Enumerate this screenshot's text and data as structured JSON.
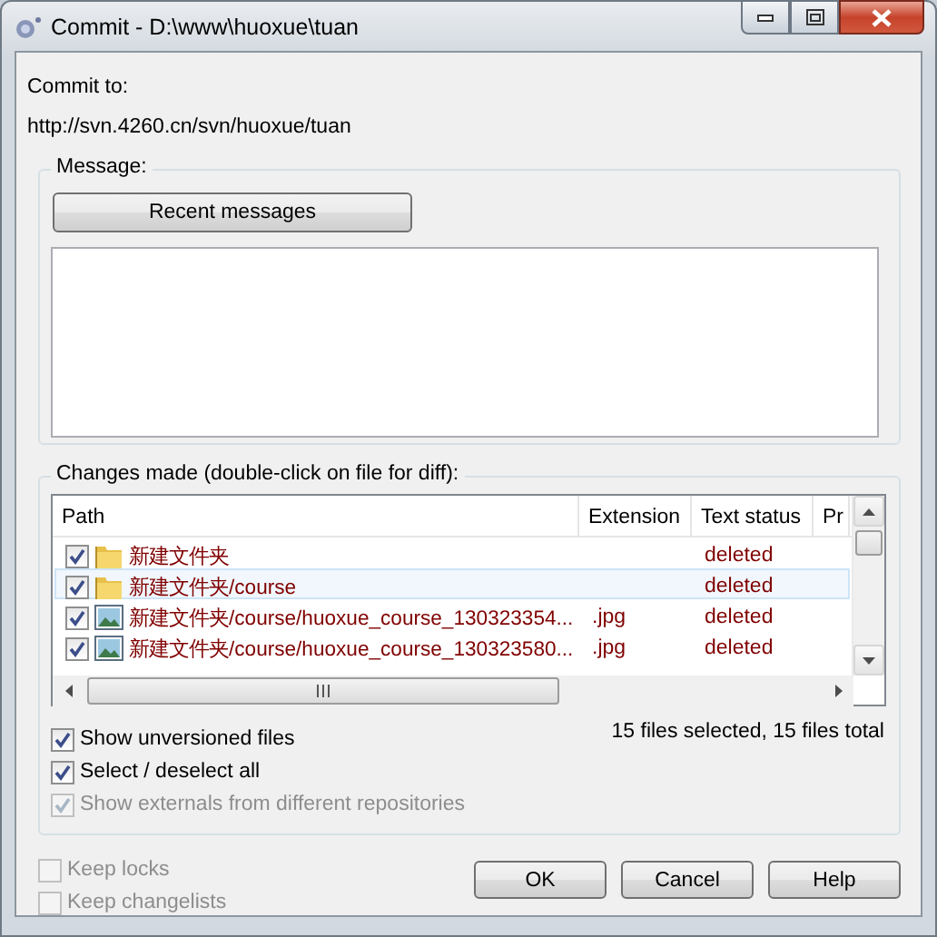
{
  "window": {
    "title": "Commit - D:\\www\\huoxue\\tuan"
  },
  "commit_to": {
    "label": "Commit to:",
    "url": "http://svn.4260.cn/svn/huoxue/tuan"
  },
  "message": {
    "label": "Message:",
    "recent_button": "Recent messages"
  },
  "changes": {
    "label": "Changes made (double-click on file for diff):",
    "columns": [
      "Path",
      "Extension",
      "Text status",
      "Pr"
    ],
    "rows": [
      {
        "kind": "folder",
        "checked": true,
        "selected": false,
        "path": "新建文件夹",
        "extension": "",
        "status": "deleted"
      },
      {
        "kind": "folder",
        "checked": true,
        "selected": true,
        "path": "新建文件夹/course",
        "extension": "",
        "status": "deleted"
      },
      {
        "kind": "image",
        "checked": true,
        "selected": false,
        "path": "新建文件夹/course/huoxue_course_130323354...",
        "extension": ".jpg",
        "status": "deleted"
      },
      {
        "kind": "image",
        "checked": true,
        "selected": false,
        "path": "新建文件夹/course/huoxue_course_130323580...",
        "extension": ".jpg",
        "status": "deleted"
      }
    ],
    "options": [
      {
        "label": "Show unversioned files",
        "checked": true,
        "disabled": false
      },
      {
        "label": "Select / deselect all",
        "checked": true,
        "disabled": false
      },
      {
        "label": "Show externals from different repositories",
        "checked": true,
        "disabled": true
      }
    ],
    "summary": "15 files selected, 15 files total"
  },
  "bottom_options": [
    {
      "label": "Keep locks",
      "checked": false,
      "disabled": true
    },
    {
      "label": "Keep changelists",
      "checked": false,
      "disabled": true
    }
  ],
  "buttons": [
    "OK",
    "Cancel",
    "Help"
  ]
}
